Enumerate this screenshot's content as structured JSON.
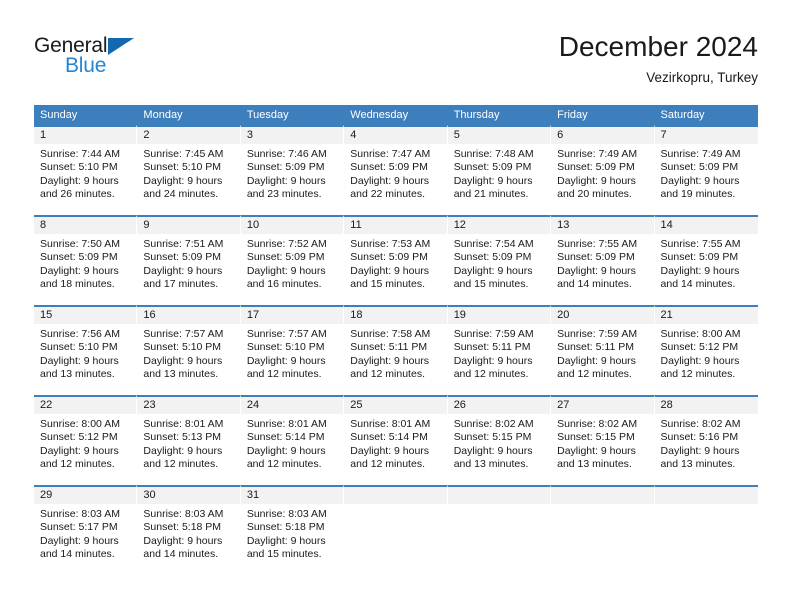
{
  "logo": {
    "word_one": "General",
    "word_two": "Blue",
    "triangle": "triangle-icon",
    "accent_dark": "#1269b0",
    "accent_light": "#2585d3"
  },
  "header": {
    "title": "December 2024",
    "subtitle": "Vezirkopru, Turkey"
  },
  "colors": {
    "header_blue": "#3d7ebd",
    "cell_gray": "#f2f2f2",
    "text": "#1a1a1a"
  },
  "weekdays": [
    "Sunday",
    "Monday",
    "Tuesday",
    "Wednesday",
    "Thursday",
    "Friday",
    "Saturday"
  ],
  "weeks": [
    [
      {
        "day": "1",
        "sunrise": "Sunrise: 7:44 AM",
        "sunset": "Sunset: 5:10 PM",
        "daylight1": "Daylight: 9 hours",
        "daylight2": "and 26 minutes."
      },
      {
        "day": "2",
        "sunrise": "Sunrise: 7:45 AM",
        "sunset": "Sunset: 5:10 PM",
        "daylight1": "Daylight: 9 hours",
        "daylight2": "and 24 minutes."
      },
      {
        "day": "3",
        "sunrise": "Sunrise: 7:46 AM",
        "sunset": "Sunset: 5:09 PM",
        "daylight1": "Daylight: 9 hours",
        "daylight2": "and 23 minutes."
      },
      {
        "day": "4",
        "sunrise": "Sunrise: 7:47 AM",
        "sunset": "Sunset: 5:09 PM",
        "daylight1": "Daylight: 9 hours",
        "daylight2": "and 22 minutes."
      },
      {
        "day": "5",
        "sunrise": "Sunrise: 7:48 AM",
        "sunset": "Sunset: 5:09 PM",
        "daylight1": "Daylight: 9 hours",
        "daylight2": "and 21 minutes."
      },
      {
        "day": "6",
        "sunrise": "Sunrise: 7:49 AM",
        "sunset": "Sunset: 5:09 PM",
        "daylight1": "Daylight: 9 hours",
        "daylight2": "and 20 minutes."
      },
      {
        "day": "7",
        "sunrise": "Sunrise: 7:49 AM",
        "sunset": "Sunset: 5:09 PM",
        "daylight1": "Daylight: 9 hours",
        "daylight2": "and 19 minutes."
      }
    ],
    [
      {
        "day": "8",
        "sunrise": "Sunrise: 7:50 AM",
        "sunset": "Sunset: 5:09 PM",
        "daylight1": "Daylight: 9 hours",
        "daylight2": "and 18 minutes."
      },
      {
        "day": "9",
        "sunrise": "Sunrise: 7:51 AM",
        "sunset": "Sunset: 5:09 PM",
        "daylight1": "Daylight: 9 hours",
        "daylight2": "and 17 minutes."
      },
      {
        "day": "10",
        "sunrise": "Sunrise: 7:52 AM",
        "sunset": "Sunset: 5:09 PM",
        "daylight1": "Daylight: 9 hours",
        "daylight2": "and 16 minutes."
      },
      {
        "day": "11",
        "sunrise": "Sunrise: 7:53 AM",
        "sunset": "Sunset: 5:09 PM",
        "daylight1": "Daylight: 9 hours",
        "daylight2": "and 15 minutes."
      },
      {
        "day": "12",
        "sunrise": "Sunrise: 7:54 AM",
        "sunset": "Sunset: 5:09 PM",
        "daylight1": "Daylight: 9 hours",
        "daylight2": "and 15 minutes."
      },
      {
        "day": "13",
        "sunrise": "Sunrise: 7:55 AM",
        "sunset": "Sunset: 5:09 PM",
        "daylight1": "Daylight: 9 hours",
        "daylight2": "and 14 minutes."
      },
      {
        "day": "14",
        "sunrise": "Sunrise: 7:55 AM",
        "sunset": "Sunset: 5:09 PM",
        "daylight1": "Daylight: 9 hours",
        "daylight2": "and 14 minutes."
      }
    ],
    [
      {
        "day": "15",
        "sunrise": "Sunrise: 7:56 AM",
        "sunset": "Sunset: 5:10 PM",
        "daylight1": "Daylight: 9 hours",
        "daylight2": "and 13 minutes."
      },
      {
        "day": "16",
        "sunrise": "Sunrise: 7:57 AM",
        "sunset": "Sunset: 5:10 PM",
        "daylight1": "Daylight: 9 hours",
        "daylight2": "and 13 minutes."
      },
      {
        "day": "17",
        "sunrise": "Sunrise: 7:57 AM",
        "sunset": "Sunset: 5:10 PM",
        "daylight1": "Daylight: 9 hours",
        "daylight2": "and 12 minutes."
      },
      {
        "day": "18",
        "sunrise": "Sunrise: 7:58 AM",
        "sunset": "Sunset: 5:11 PM",
        "daylight1": "Daylight: 9 hours",
        "daylight2": "and 12 minutes."
      },
      {
        "day": "19",
        "sunrise": "Sunrise: 7:59 AM",
        "sunset": "Sunset: 5:11 PM",
        "daylight1": "Daylight: 9 hours",
        "daylight2": "and 12 minutes."
      },
      {
        "day": "20",
        "sunrise": "Sunrise: 7:59 AM",
        "sunset": "Sunset: 5:11 PM",
        "daylight1": "Daylight: 9 hours",
        "daylight2": "and 12 minutes."
      },
      {
        "day": "21",
        "sunrise": "Sunrise: 8:00 AM",
        "sunset": "Sunset: 5:12 PM",
        "daylight1": "Daylight: 9 hours",
        "daylight2": "and 12 minutes."
      }
    ],
    [
      {
        "day": "22",
        "sunrise": "Sunrise: 8:00 AM",
        "sunset": "Sunset: 5:12 PM",
        "daylight1": "Daylight: 9 hours",
        "daylight2": "and 12 minutes."
      },
      {
        "day": "23",
        "sunrise": "Sunrise: 8:01 AM",
        "sunset": "Sunset: 5:13 PM",
        "daylight1": "Daylight: 9 hours",
        "daylight2": "and 12 minutes."
      },
      {
        "day": "24",
        "sunrise": "Sunrise: 8:01 AM",
        "sunset": "Sunset: 5:14 PM",
        "daylight1": "Daylight: 9 hours",
        "daylight2": "and 12 minutes."
      },
      {
        "day": "25",
        "sunrise": "Sunrise: 8:01 AM",
        "sunset": "Sunset: 5:14 PM",
        "daylight1": "Daylight: 9 hours",
        "daylight2": "and 12 minutes."
      },
      {
        "day": "26",
        "sunrise": "Sunrise: 8:02 AM",
        "sunset": "Sunset: 5:15 PM",
        "daylight1": "Daylight: 9 hours",
        "daylight2": "and 13 minutes."
      },
      {
        "day": "27",
        "sunrise": "Sunrise: 8:02 AM",
        "sunset": "Sunset: 5:15 PM",
        "daylight1": "Daylight: 9 hours",
        "daylight2": "and 13 minutes."
      },
      {
        "day": "28",
        "sunrise": "Sunrise: 8:02 AM",
        "sunset": "Sunset: 5:16 PM",
        "daylight1": "Daylight: 9 hours",
        "daylight2": "and 13 minutes."
      }
    ],
    [
      {
        "day": "29",
        "sunrise": "Sunrise: 8:03 AM",
        "sunset": "Sunset: 5:17 PM",
        "daylight1": "Daylight: 9 hours",
        "daylight2": "and 14 minutes."
      },
      {
        "day": "30",
        "sunrise": "Sunrise: 8:03 AM",
        "sunset": "Sunset: 5:18 PM",
        "daylight1": "Daylight: 9 hours",
        "daylight2": "and 14 minutes."
      },
      {
        "day": "31",
        "sunrise": "Sunrise: 8:03 AM",
        "sunset": "Sunset: 5:18 PM",
        "daylight1": "Daylight: 9 hours",
        "daylight2": "and 15 minutes."
      },
      {
        "day": "",
        "sunrise": "",
        "sunset": "",
        "daylight1": "",
        "daylight2": ""
      },
      {
        "day": "",
        "sunrise": "",
        "sunset": "",
        "daylight1": "",
        "daylight2": ""
      },
      {
        "day": "",
        "sunrise": "",
        "sunset": "",
        "daylight1": "",
        "daylight2": ""
      },
      {
        "day": "",
        "sunrise": "",
        "sunset": "",
        "daylight1": "",
        "daylight2": ""
      }
    ]
  ]
}
